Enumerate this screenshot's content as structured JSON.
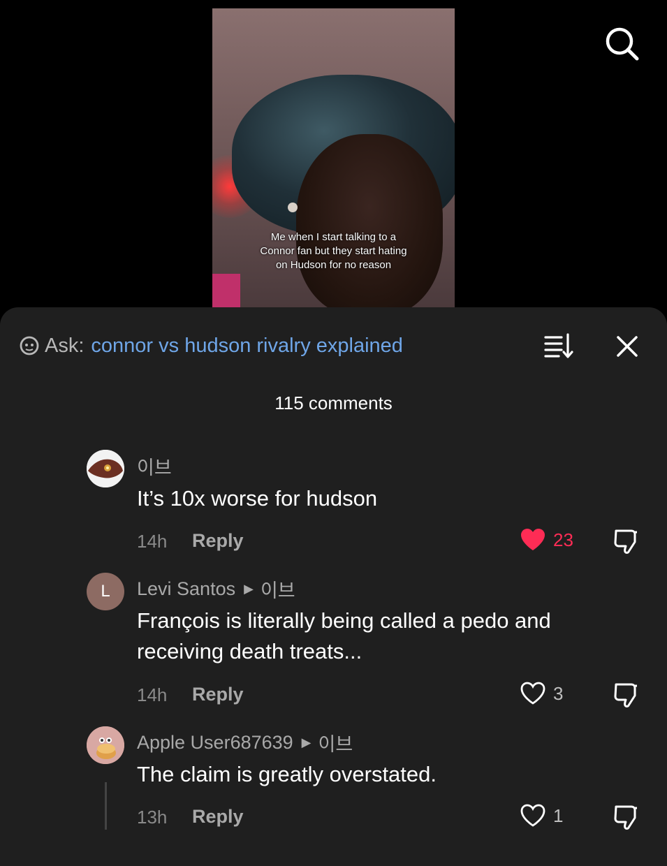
{
  "video": {
    "caption": "Me when I start talking to a Connor fan but they start hating on Hudson for no reason"
  },
  "icons": {
    "search": "search-icon",
    "ask": "ask-bot-icon",
    "sort": "sort-icon",
    "close": "close-icon",
    "like": "heart-icon",
    "dislike": "thumbs-down-icon"
  },
  "ask": {
    "label": "Ask:",
    "query": "connor vs hudson rivalry explained"
  },
  "comments_count": "115 comments",
  "colors": {
    "panel_bg": "#1f1f1f",
    "link_blue": "#6fa6e8",
    "like_red": "#fe2c55",
    "muted_text": "#a9a9a9"
  },
  "comments": [
    {
      "user": "이브",
      "reply_to": "",
      "text": "It’s 10x worse for hudson",
      "time": "14h",
      "reply_label": "Reply",
      "likes": "23",
      "liked": true
    },
    {
      "user": "Levi Santos",
      "avatar_letter": "L",
      "reply_to": "이브",
      "text": "François is literally being called a pedo and receiving death treats...",
      "time": "14h",
      "reply_label": "Reply",
      "likes": "3",
      "liked": false
    },
    {
      "user": "Apple User687639",
      "reply_to": "이브",
      "text": "The claim is greatly overstated.",
      "time": "13h",
      "reply_label": "Reply",
      "likes": "1",
      "liked": false
    }
  ]
}
